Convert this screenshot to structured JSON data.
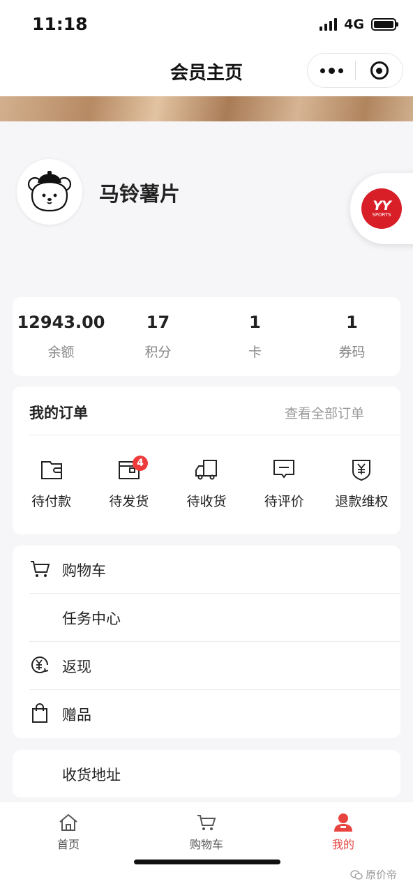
{
  "status_bar": {
    "time": "11:18",
    "network": "4G"
  },
  "nav": {
    "title": "会员主页"
  },
  "profile": {
    "name": "马铃薯片",
    "brand_logo_text": "YY",
    "brand_logo_sub": "SPORTS"
  },
  "stats": [
    {
      "value": "12943.00",
      "label": "余额"
    },
    {
      "value": "17",
      "label": "积分"
    },
    {
      "value": "1",
      "label": "卡"
    },
    {
      "value": "1",
      "label": "券码"
    }
  ],
  "orders": {
    "title": "我的订单",
    "view_all": "查看全部订单",
    "items": [
      {
        "label": "待付款",
        "icon": "wallet-icon"
      },
      {
        "label": "待发货",
        "icon": "box-icon",
        "badge": "4"
      },
      {
        "label": "待收货",
        "icon": "truck-icon"
      },
      {
        "label": "待评价",
        "icon": "comment-icon"
      },
      {
        "label": "退款维权",
        "icon": "refund-icon"
      }
    ]
  },
  "menu": [
    {
      "label": "购物车",
      "icon": "cart-icon"
    },
    {
      "label": "任务中心",
      "icon": ""
    },
    {
      "label": "返现",
      "icon": "cashback-icon"
    },
    {
      "label": "赠品",
      "icon": "gift-bag-icon"
    }
  ],
  "address": {
    "label": "收货地址"
  },
  "tabbar": [
    {
      "label": "首页",
      "icon": "home-icon",
      "active": false
    },
    {
      "label": "购物车",
      "icon": "cart-icon",
      "active": false
    },
    {
      "label": "我的",
      "icon": "user-icon",
      "active": true
    }
  ],
  "colors": {
    "accent": "#e8443f",
    "badge": "#ee3a3a",
    "brand_red": "#d81e27"
  },
  "watermark": "原价帝"
}
